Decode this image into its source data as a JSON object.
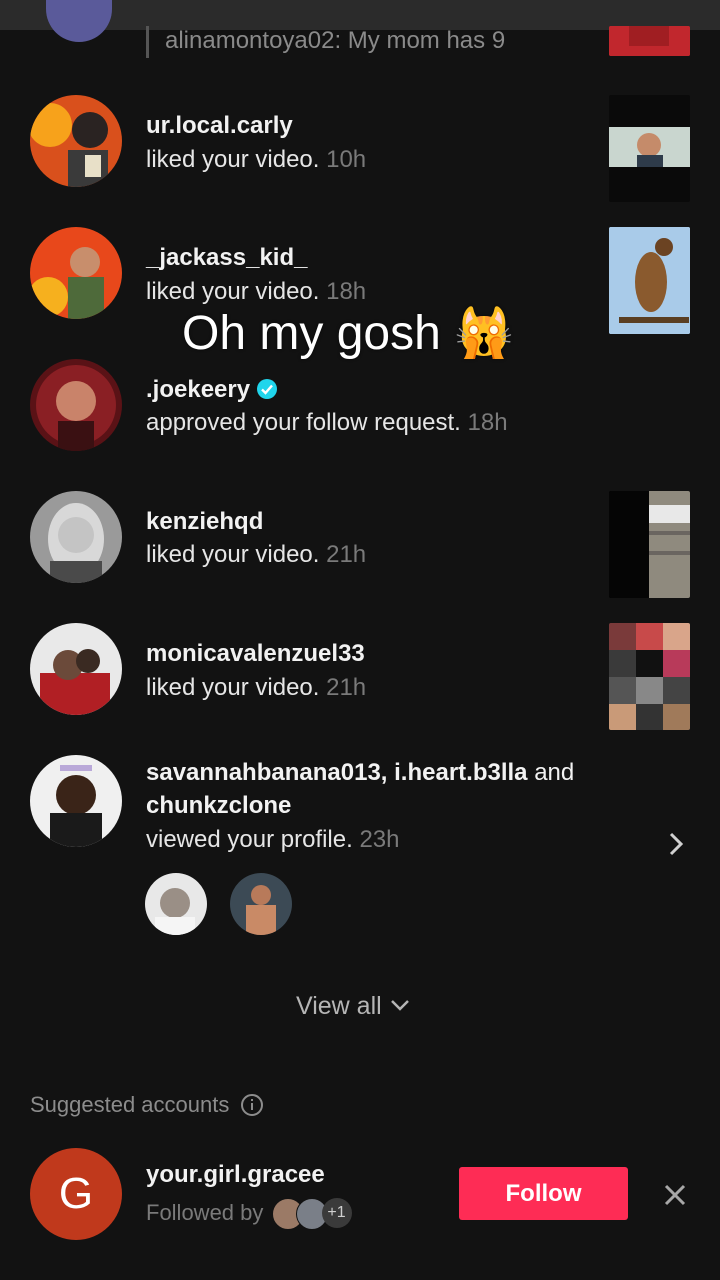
{
  "partial_row": {
    "text": "alinamontoya02: My mom has 9"
  },
  "notifications": [
    {
      "username": "ur.local.carly",
      "action": "liked your video.",
      "time": "10h"
    },
    {
      "username": "_jackass_kid_",
      "action": "liked your video.",
      "time": "18h"
    },
    {
      "username": ".joekeery",
      "verified": true,
      "action": "approved your follow request.",
      "time": "18h"
    },
    {
      "username": "kenziehqd",
      "action": "liked your video.",
      "time": "21h"
    },
    {
      "username": "monicavalenzuel33",
      "action": "liked your video.",
      "time": "21h"
    },
    {
      "username_line1": "savannahbanana013, i.heart.b3lla",
      "and_word": "and",
      "username_line2": "chunkzclone",
      "action": "viewed your profile.",
      "time": "23h"
    }
  ],
  "overlay_caption": "Oh my gosh 🙀",
  "view_all": {
    "label": "View all"
  },
  "suggested": {
    "header": "Suggested accounts",
    "account": {
      "initial": "G",
      "username": "your.girl.gracee",
      "followed_by_label": "Followed by",
      "extra_count": "+1",
      "follow_label": "Follow"
    }
  },
  "colors": {
    "background": "#121212",
    "follow_button": "#fe2c55",
    "verified": "#20d5ec",
    "time_text": "#7a7a7a"
  }
}
